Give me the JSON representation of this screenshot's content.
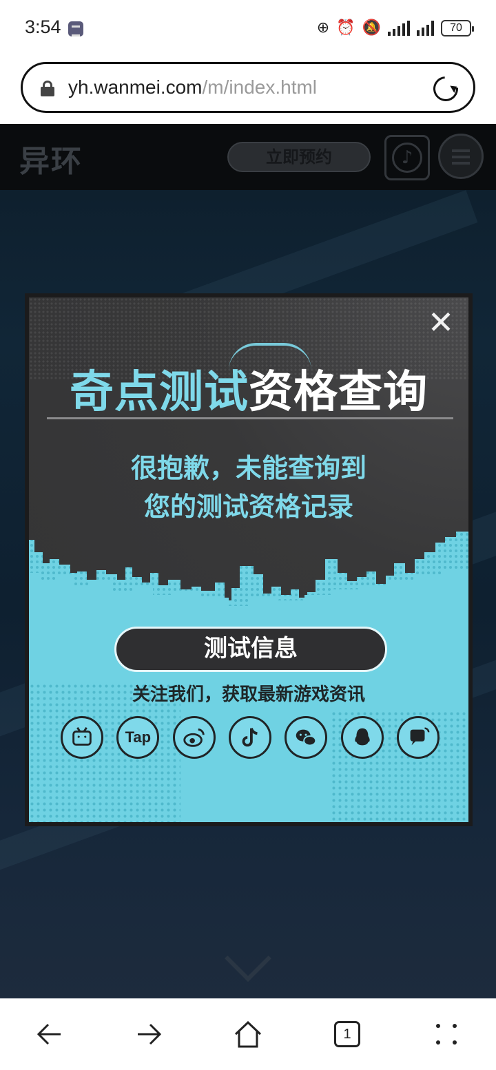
{
  "status_bar": {
    "time": "3:54",
    "battery": "70"
  },
  "browser": {
    "url_host": "yh.wanmei.com",
    "url_path": "/m/index.html"
  },
  "site_header": {
    "logo": "异环",
    "reserve_button": "立即预约"
  },
  "modal": {
    "title_part1": "奇点测试",
    "title_part2": "资格查询",
    "message_line1": "很抱歉，未能查询到",
    "message_line2": "您的测试资格记录",
    "test_info_button": "测试信息",
    "follow_text": "关注我们，获取最新游戏资讯",
    "social_icons": [
      "bilibili-icon",
      "taptap-icon",
      "weibo-icon",
      "douyin-icon",
      "wechat-icon",
      "qq-icon",
      "community-icon"
    ],
    "tap_label": "Tap"
  },
  "bottom_nav": {
    "tab_count": "1"
  },
  "colors": {
    "accent_cyan": "#7fd9ea",
    "modal_bg": "#3a3a3c",
    "header_bg": "#0a0c0e"
  }
}
